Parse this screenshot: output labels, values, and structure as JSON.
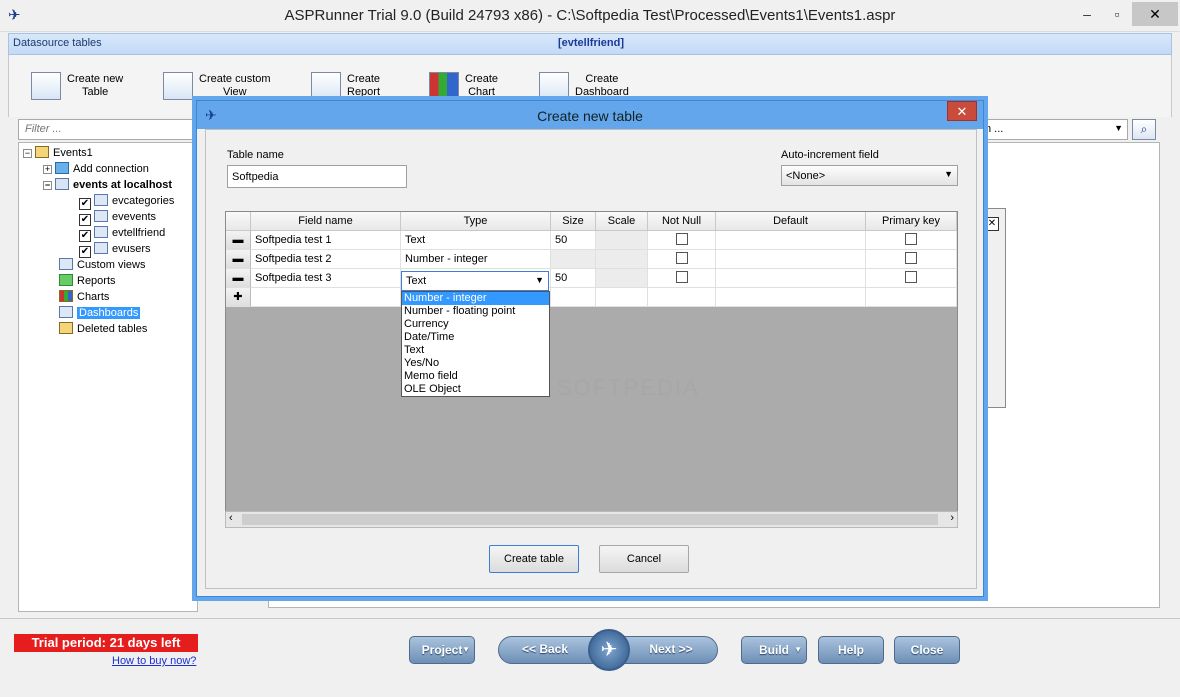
{
  "window": {
    "title": "ASPRunner Trial 9.0 (Build 24793 x86) - C:\\Softpedia Test\\Processed\\Events1\\Events1.aspr",
    "minimize": "‒",
    "maximize": "▫",
    "close": "✕"
  },
  "datasource_bar": {
    "label": "Datasource tables",
    "active_table": "[evtellfriend]"
  },
  "ribbon": {
    "items": [
      {
        "label": "Create new\nTable",
        "icon": "table-icon"
      },
      {
        "label": "Create custom\nView",
        "icon": "view-icon"
      },
      {
        "label": "Create\nReport",
        "icon": "report-icon"
      },
      {
        "label": "Create\nChart",
        "icon": "chart-icon"
      },
      {
        "label": "Create\nDashboard",
        "icon": "dashboard-icon"
      }
    ]
  },
  "filter": {
    "placeholder": "Filter ..."
  },
  "right_select": {
    "value": "n ..."
  },
  "tree": {
    "root": "Events1",
    "add_connection": "Add connection",
    "connection": "events at localhost",
    "tables": [
      "evcategories",
      "evevents",
      "evtellfriend",
      "evusers"
    ],
    "custom_views": "Custom views",
    "reports": "Reports",
    "charts": "Charts",
    "dashboards": "Dashboards",
    "deleted": "Deleted tables"
  },
  "bottom": {
    "trial": "Trial period: 21 days left",
    "how_to_buy": "How to buy now?",
    "project": "Project",
    "back": "<< Back",
    "next": "Next >>",
    "build": "Build",
    "help": "Help",
    "close": "Close"
  },
  "dialog": {
    "title": "Create new table",
    "close": "✕",
    "table_name_label": "Table name",
    "table_name_value": "Softpedia",
    "auto_increment_label": "Auto-increment field",
    "auto_increment_value": "<None>",
    "columns": [
      "Field name",
      "Type",
      "Size",
      "Scale",
      "Not Null",
      "Default",
      "Primary key"
    ],
    "rows": [
      {
        "field": "Softpedia test 1",
        "type": "Text",
        "size": "50"
      },
      {
        "field": "Softpedia test 2",
        "type": "Number - integer",
        "size": ""
      },
      {
        "field": "Softpedia test 3",
        "type": "Text",
        "size": "50"
      }
    ],
    "type_options": [
      "Number - integer",
      "Number - floating point",
      "Currency",
      "Date/Time",
      "Text",
      "Yes/No",
      "Memo field",
      "OLE Object"
    ],
    "selected_option": "Number - integer",
    "create_button": "Create table",
    "cancel_button": "Cancel"
  },
  "watermark": "SOFTPEDIA"
}
